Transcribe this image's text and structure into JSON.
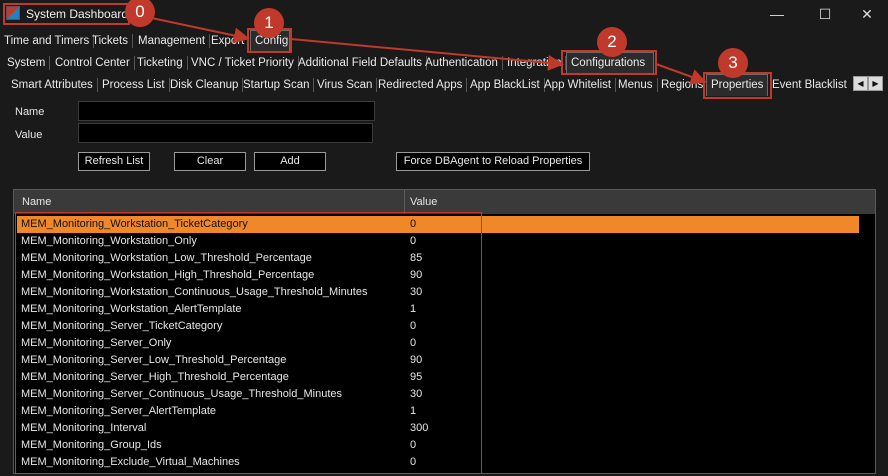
{
  "window": {
    "title": "System Dashboard",
    "minimize": "—",
    "maximize": "☐",
    "close": "✕"
  },
  "tabs_row1": [
    "Time and Timers",
    "Tickets",
    "Management",
    "Export",
    "Config"
  ],
  "tabs_row2": [
    "System",
    "Control Center",
    "Ticketing",
    "VNC / Ticket Priority",
    "Additional Field Defaults",
    "Authentication",
    "Integration",
    "Configurations"
  ],
  "tabs_row3": [
    "Smart Attributes",
    "Process List",
    "Disk Cleanup",
    "Startup Scan",
    "Virus Scan",
    "Redirected Apps",
    "App BlackList",
    "App Whitelist",
    "Menus",
    "Regions",
    "Properties",
    "Event Blacklist"
  ],
  "scroll": {
    "left": "◀",
    "right": "▶"
  },
  "form": {
    "name_label": "Name",
    "value_label": "Value",
    "name_value": "",
    "value_value": "",
    "refresh_label": "Refresh List",
    "clear_label": "Clear",
    "add_label": "Add",
    "force_label": "Force DBAgent to Reload Properties"
  },
  "table": {
    "columns": [
      "Name",
      "Value"
    ],
    "rows": [
      [
        "MEM_Monitoring_Workstation_TicketCategory",
        "0"
      ],
      [
        "MEM_Monitoring_Workstation_Only",
        "0"
      ],
      [
        "MEM_Monitoring_Workstation_Low_Threshold_Percentage",
        "85"
      ],
      [
        "MEM_Monitoring_Workstation_High_Threshold_Percentage",
        "90"
      ],
      [
        "MEM_Monitoring_Workstation_Continuous_Usage_Threshold_Minutes",
        "30"
      ],
      [
        "MEM_Monitoring_Workstation_AlertTemplate",
        "1"
      ],
      [
        "MEM_Monitoring_Server_TicketCategory",
        "0"
      ],
      [
        "MEM_Monitoring_Server_Only",
        "0"
      ],
      [
        "MEM_Monitoring_Server_Low_Threshold_Percentage",
        "90"
      ],
      [
        "MEM_Monitoring_Server_High_Threshold_Percentage",
        "95"
      ],
      [
        "MEM_Monitoring_Server_Continuous_Usage_Threshold_Minutes",
        "30"
      ],
      [
        "MEM_Monitoring_Server_AlertTemplate",
        "1"
      ],
      [
        "MEM_Monitoring_Interval",
        "300"
      ],
      [
        "MEM_Monitoring_Group_Ids",
        "0"
      ],
      [
        "MEM_Monitoring_Exclude_Virtual_Machines",
        "0"
      ]
    ],
    "selected_row": 0
  },
  "annotations": {
    "markers": [
      "0",
      "1",
      "2",
      "3"
    ],
    "color": "#c0392b"
  },
  "colors": {
    "background": "#1a1a1a",
    "selection": "#f0882a",
    "annotation": "#c0392b"
  }
}
